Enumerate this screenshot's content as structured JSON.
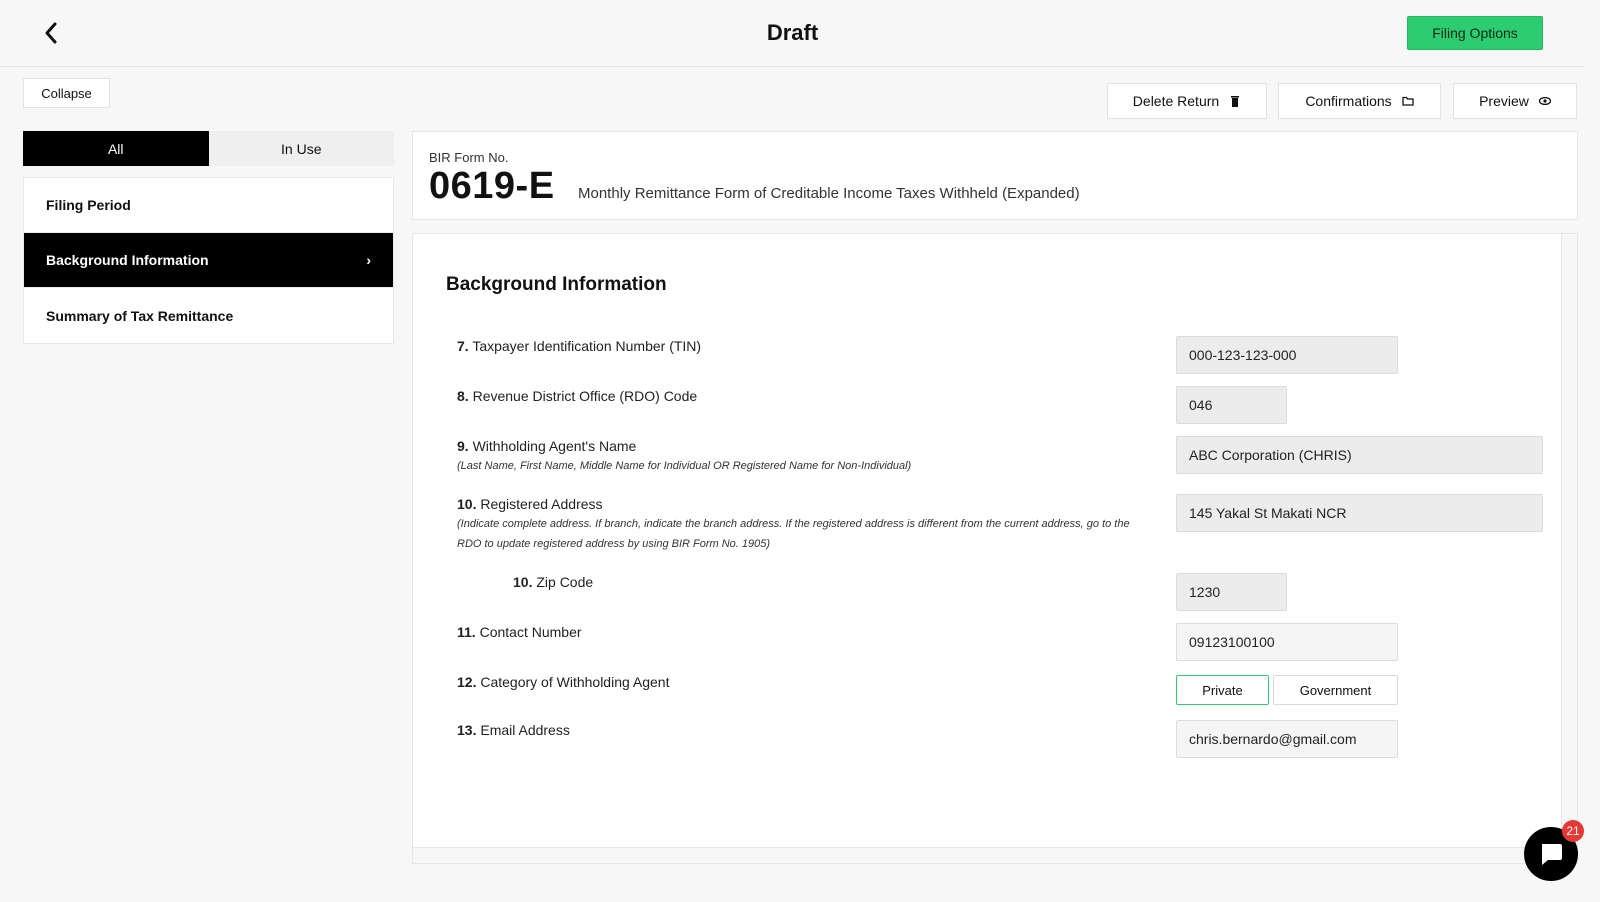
{
  "header": {
    "title": "Draft",
    "filing_options_label": "Filing Options"
  },
  "sidebar": {
    "collapse_label": "Collapse",
    "tabs": [
      {
        "label": "All"
      },
      {
        "label": "In Use"
      }
    ],
    "items": [
      {
        "label": "Filing Period"
      },
      {
        "label": "Background Information",
        "chevron": "›"
      },
      {
        "label": "Summary of Tax Remittance"
      }
    ]
  },
  "toolbar": {
    "delete_label": "Delete Return",
    "confirmations_label": "Confirmations",
    "preview_label": "Preview"
  },
  "form": {
    "label": "BIR Form No.",
    "number": "0619-E",
    "description": "Monthly Remittance Form of Creditable Income Taxes Withheld (Expanded)"
  },
  "section": {
    "title": "Background Information",
    "fields": [
      {
        "num": "7.",
        "label": "Taxpayer Identification Number (TIN)",
        "value": "000-123-123-000"
      },
      {
        "num": "8.",
        "label": "Revenue District Office (RDO) Code",
        "value": "046"
      },
      {
        "num": "9.",
        "label": "Withholding Agent's Name",
        "note": "(Last Name, First Name, Middle Name for Individual OR Registered Name for Non-Individual)",
        "value": "ABC Corporation (CHRIS)"
      },
      {
        "num": "10.",
        "label": "Registered Address",
        "note": "(Indicate complete address. If branch, indicate the branch address. If the registered address is different from the current address, go to the RDO to update registered address by using BIR Form No. 1905)",
        "value": "145 Yakal St Makati NCR"
      },
      {
        "num": "10.",
        "label": "Zip Code",
        "value": "1230"
      },
      {
        "num": "11.",
        "label": "Contact Number",
        "value": "09123100100"
      },
      {
        "num": "12.",
        "label": "Category of Withholding Agent",
        "options": [
          "Private",
          "Government"
        ],
        "selected": "Private"
      },
      {
        "num": "13.",
        "label": "Email Address",
        "value": "chris.bernardo@gmail.com"
      }
    ]
  },
  "chat": {
    "badge": "21"
  },
  "colors": {
    "accent_green": "#2ecc71",
    "badge_red": "#e53935"
  }
}
